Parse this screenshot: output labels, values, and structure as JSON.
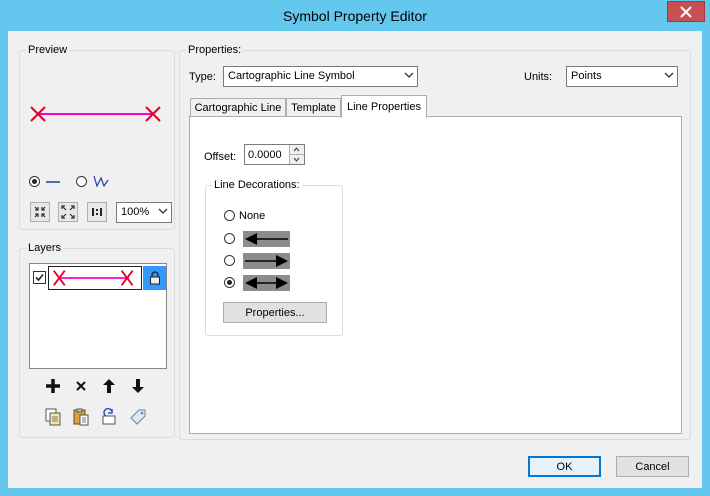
{
  "window": {
    "title": "Symbol Property Editor"
  },
  "preview": {
    "label": "Preview",
    "zoom_value": "100%"
  },
  "layers": {
    "label": "Layers"
  },
  "properties": {
    "label": "Properties:",
    "type_label": "Type:",
    "type_value": "Cartographic Line Symbol",
    "units_label": "Units:",
    "units_value": "Points",
    "tabs": [
      "Cartographic Line",
      "Template",
      "Line Properties"
    ],
    "active_tab": "Line Properties",
    "offset_label": "Offset:",
    "offset_value": "0.0000",
    "decorations": {
      "label": "Line Decorations:",
      "none_label": "None",
      "selected_index": 3,
      "properties_button": "Properties..."
    }
  },
  "buttons": {
    "ok": "OK",
    "cancel": "Cancel"
  },
  "colors": {
    "line": "#ff00cc",
    "marker": "#e0002a",
    "accent": "#64c8ee"
  }
}
